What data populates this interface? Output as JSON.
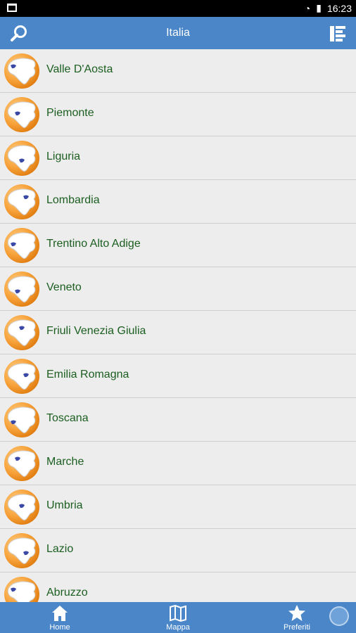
{
  "statusbar": {
    "time": "16:23"
  },
  "appbar": {
    "title": "Italia"
  },
  "list": {
    "items": [
      {
        "label": "Valle D'Aosta"
      },
      {
        "label": "Piemonte"
      },
      {
        "label": "Liguria"
      },
      {
        "label": "Lombardia"
      },
      {
        "label": "Trentino Alto Adige"
      },
      {
        "label": "Veneto"
      },
      {
        "label": "Friuli Venezia Giulia"
      },
      {
        "label": "Emilia Romagna"
      },
      {
        "label": "Toscana"
      },
      {
        "label": "Marche"
      },
      {
        "label": "Umbria"
      },
      {
        "label": "Lazio"
      },
      {
        "label": "Abruzzo"
      }
    ]
  },
  "tabbar": {
    "home": "Home",
    "map": "Mappa",
    "favorites": "Preferiti"
  },
  "colors": {
    "accent": "#4a86c8",
    "label": "#1b5e20",
    "avatar": "#f7a23a"
  }
}
